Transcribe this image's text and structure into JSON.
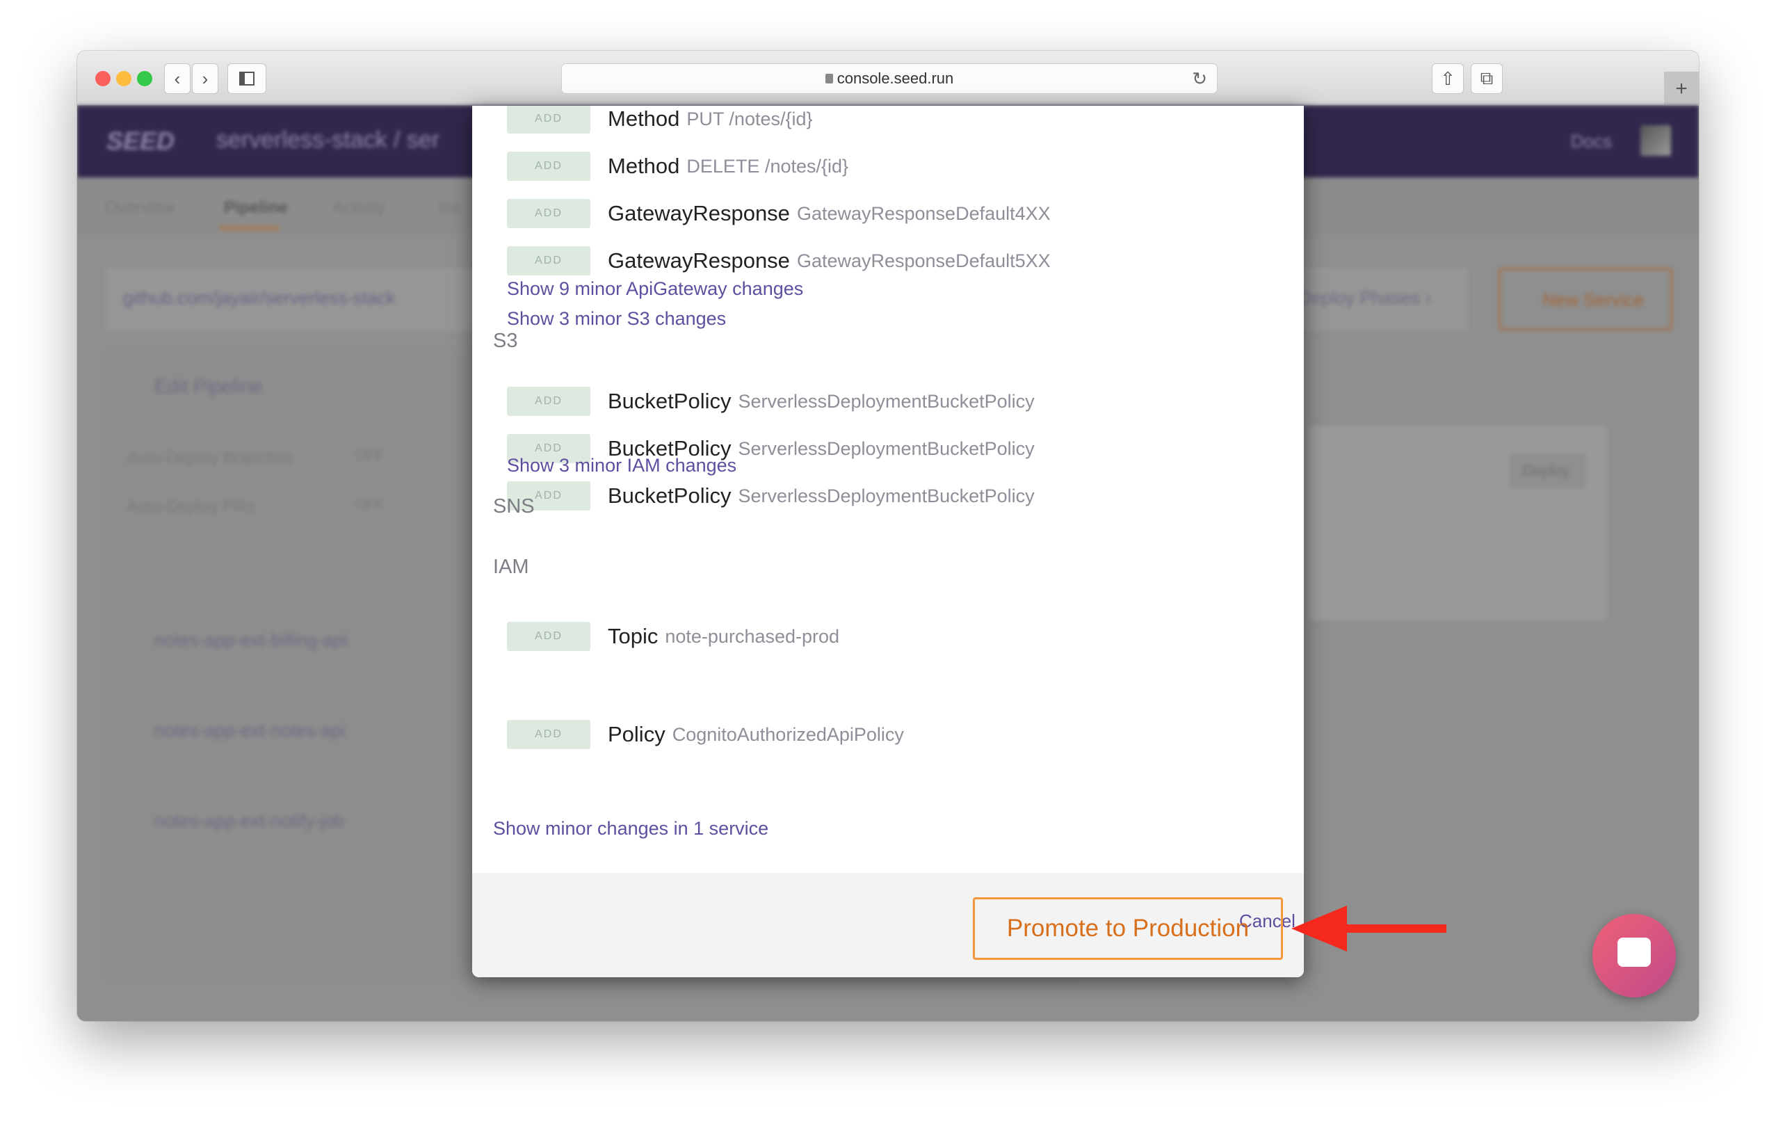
{
  "browser": {
    "url": "console.seed.run"
  },
  "app": {
    "logo": "SEED",
    "breadcrumb": "serverless-stack / ser",
    "docs": "Docs",
    "tabs": [
      "Overview",
      "Pipeline",
      "Activity",
      "Iss"
    ],
    "repo": "github.com/jayair/serverless-stack",
    "deploy_phases": "ge Deploy Phases ›",
    "new_service": "New Service",
    "edit_pipeline": "Edit Pipeline",
    "settings": [
      {
        "label": "Auto-Deploy Branches",
        "value": "OFF"
      },
      {
        "label": "Auto-Deploy PRs",
        "value": "OFF"
      }
    ],
    "services": [
      "notes-app-ext-billing-api",
      "notes-app-ext-notes-api",
      "notes-app-ext-notify-job"
    ],
    "deploy": "Deploy"
  },
  "modal": {
    "groups": [
      {
        "title": "",
        "rows": [
          {
            "badge": "ADD",
            "type": "Method",
            "name": "PUT /notes/{id}"
          },
          {
            "badge": "ADD",
            "type": "Method",
            "name": "DELETE /notes/{id}"
          },
          {
            "badge": "ADD",
            "type": "GatewayResponse",
            "name": "GatewayResponseDefault4XX"
          },
          {
            "badge": "ADD",
            "type": "GatewayResponse",
            "name": "GatewayResponseDefault5XX"
          }
        ],
        "link": "Show 9 minor ApiGateway changes"
      },
      {
        "title": "S3",
        "rows": [
          {
            "badge": "ADD",
            "type": "BucketPolicy",
            "name": "ServerlessDeploymentBucketPolicy"
          },
          {
            "badge": "ADD",
            "type": "BucketPolicy",
            "name": "ServerlessDeploymentBucketPolicy"
          },
          {
            "badge": "ADD",
            "type": "BucketPolicy",
            "name": "ServerlessDeploymentBucketPolicy"
          }
        ],
        "link": "Show 3 minor S3 changes"
      },
      {
        "title": "SNS",
        "rows": [
          {
            "badge": "ADD",
            "type": "Topic",
            "name": "note-purchased-prod"
          }
        ]
      },
      {
        "title": "IAM",
        "rows": [
          {
            "badge": "ADD",
            "type": "Policy",
            "name": "CognitoAuthorizedApiPolicy"
          }
        ],
        "link": "Show 3 minor IAM changes"
      }
    ],
    "service_link": "Show minor changes in 1 service",
    "cancel": "Cancel",
    "promote": "Promote to Production"
  },
  "colors": {
    "accent": "#5f4ea0",
    "promote": "#f5973b",
    "arrow": "#f5281e",
    "badge_bg": "#deeadf"
  }
}
